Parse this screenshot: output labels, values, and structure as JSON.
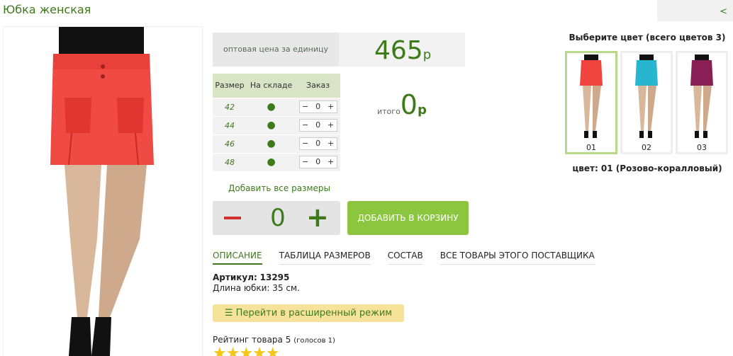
{
  "page": {
    "title": "Юбка женская",
    "back_label": "<"
  },
  "price": {
    "label": "оптовая цена за единицу",
    "value": "465",
    "currency": "р"
  },
  "size_table": {
    "headers": [
      "Размер",
      "На складе",
      "Заказ"
    ],
    "rows": [
      {
        "size": "42",
        "stock": "●",
        "qty": "0"
      },
      {
        "size": "44",
        "stock": "●",
        "qty": "0"
      },
      {
        "size": "46",
        "stock": "●",
        "qty": "0"
      },
      {
        "size": "48",
        "stock": "●",
        "qty": "0"
      }
    ]
  },
  "total": {
    "label": "итого",
    "value": "0",
    "currency": "р"
  },
  "add_all_label": "Добавить все размеры",
  "big_stepper": {
    "value": "0"
  },
  "cart_button": "ДОБАВИТЬ В КОРЗИНУ",
  "tabs": [
    {
      "label": "ОПИСАНИЕ",
      "active": true
    },
    {
      "label": "ТАБЛИЦА РАЗМЕРОВ"
    },
    {
      "label": "СОСТАВ"
    },
    {
      "label": "ВСЕ ТОВАРЫ ЭТОГО ПОСТАВЩИКА"
    }
  ],
  "description": {
    "article_label": "Артикул:",
    "article": "13295",
    "length": "Длина юбки: 35 см."
  },
  "advanced_button": "Перейти в расширенный режим",
  "rating": {
    "label": "Рейтинг товара 5",
    "votes": "(голосов 1)"
  },
  "colors": {
    "header": "Выберите цвет (всего цветов 3)",
    "items": [
      {
        "num": "01",
        "color": "#f0453f"
      },
      {
        "num": "02",
        "color": "#27b5d0"
      },
      {
        "num": "03",
        "color": "#8a1f55"
      }
    ],
    "selected_label": "цвет: 01 (Розово-коралловый)"
  },
  "accent": "#3d7a1a"
}
